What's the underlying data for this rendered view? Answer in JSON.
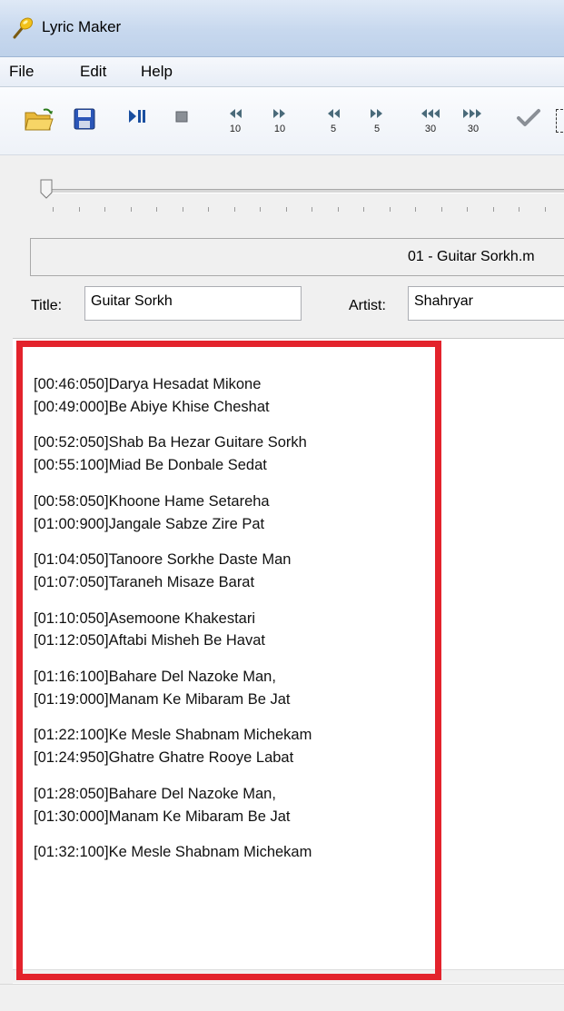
{
  "window": {
    "title": "Lyric Maker"
  },
  "menu": {
    "file": "File",
    "edit": "Edit",
    "help": "Help"
  },
  "toolbar": {
    "seek": [
      {
        "label": "10",
        "dir": "back"
      },
      {
        "label": "10",
        "dir": "fwd"
      },
      {
        "label": "5",
        "dir": "back"
      },
      {
        "label": "5",
        "dir": "fwd"
      },
      {
        "label": "30",
        "dir": "back"
      },
      {
        "label": "30",
        "dir": "fwd"
      }
    ]
  },
  "player": {
    "file_name": "01 - Guitar Sorkh.m",
    "position_fraction": 0.0
  },
  "fields": {
    "title_label": "Title:",
    "title_value": "Guitar Sorkh",
    "artist_label": "Artist:",
    "artist_value": "Shahryar"
  },
  "lyrics": {
    "blocks": [
      [
        "[00:46:050]Darya Hesadat Mikone",
        "[00:49:000]Be Abiye Khise Cheshat"
      ],
      [
        "[00:52:050]Shab Ba Hezar Guitare Sorkh",
        "[00:55:100]Miad Be Donbale Sedat"
      ],
      [
        "[00:58:050]Khoone Hame Setareha",
        "[01:00:900]Jangale Sabze Zire Pat"
      ],
      [
        "[01:04:050]Tanoore Sorkhe Daste Man",
        "[01:07:050]Taraneh Misaze Barat"
      ],
      [
        "[01:10:050]Asemoone Khakestari",
        "[01:12:050]Aftabi Misheh Be Havat"
      ],
      [
        "[01:16:100]Bahare Del Nazoke Man,",
        "[01:19:000]Manam Ke Mibaram Be Jat"
      ],
      [
        "[01:22:100]Ke Mesle Shabnam Michekam",
        "[01:24:950]Ghatre Ghatre Rooye Labat"
      ],
      [
        "[01:28:050]Bahare Del Nazoke Man,",
        "[01:30:000]Manam Ke Mibaram Be Jat"
      ],
      [
        "[01:32:100]Ke Mesle Shabnam Michekam"
      ]
    ]
  },
  "colors": {
    "highlight": "#e3232c"
  }
}
